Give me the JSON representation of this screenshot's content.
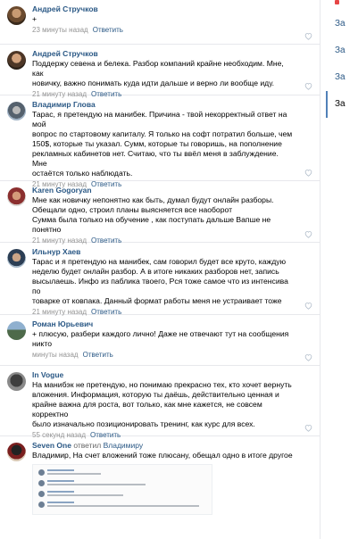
{
  "side_menu": [
    "Зa",
    "За",
    "За",
    "За"
  ],
  "comments": [
    {
      "author": "Андрей Стручков",
      "text": [
        "+"
      ],
      "time": "23 минуты назад",
      "reply": "Ответить"
    },
    {
      "author": "Андрей Стручков",
      "text": [
        "Поддержу севена и белека. Разбор компаний крайне необходим. Мне, как",
        "новичку, важно понимать куда идти дальше и верно ли вообще иду."
      ],
      "time": "21 минуту назад",
      "reply": "Ответить"
    },
    {
      "author": "Владимир Глова",
      "text": [
        "Тарас, я претендую на манибек. Причина - твой некорректный ответ на мой",
        "вопрос по стартовому капиталу. Я только на софт потратил больше, чем",
        "150$, которые ты указал. Сумм, которые ты говоришь, на пополнение",
        "рекламных кабинетов нет. Считаю, что ты ввёл меня в заблуждение. Мне",
        "остаётся только наблюдать."
      ],
      "time": "21 минуту назад",
      "reply": "Ответить"
    },
    {
      "author": "Karen Gogoryan",
      "text": [
        "Мне как новичку непонятно как быть, думал будут онлайн разборы.",
        "Обещали одно, строил планы выясняется все наоборот",
        "Сумма была только на обучение , как поступать дальше Вапше не понятно"
      ],
      "time": "21 минуту назад",
      "reply": "Ответить"
    },
    {
      "author": "Ильнур Хаев",
      "text": [
        "Тарас и я претендую на манибек, сам говорил будет все круто, каждую",
        "неделю будет онлайн разбор. А в итоге никаких разборов нет, запись",
        "высылаешь. Инфо из паблика твоего, Рся тоже самое что из интенсива по",
        "товарке от ковпака. Данный формат работы меня не устраивает тоже"
      ],
      "time": "21 минуту назад",
      "reply": "Ответить"
    },
    {
      "author": "Роман Юрьевич",
      "text": [
        "+ плюсую, разбери каждого лично! Даже не отвечают тут на сообщения",
        "никто"
      ],
      "time": "минуты назад",
      "reply": "Ответить"
    },
    {
      "author": "In Vogue",
      "text": [
        "На манибэк не претендую, но понимаю прекрасно тех, кто хочет вернуть",
        "вложения. Информация, которую ты даёшь, действительно ценная и",
        "крайне важна для роста, вот только, как мне кажется, не совсем корректно",
        "было изначально позиционировать тренинг, как курс для всех."
      ],
      "time": "55 секунд назад",
      "reply": "Ответить"
    },
    {
      "author": "Seven One",
      "action": "ответил",
      "target": "Владимиру",
      "text": [
        "Владимир, На счет вложений тоже плюсану, обещал одно в итоге другое"
      ],
      "time": "",
      "reply": ""
    }
  ]
}
